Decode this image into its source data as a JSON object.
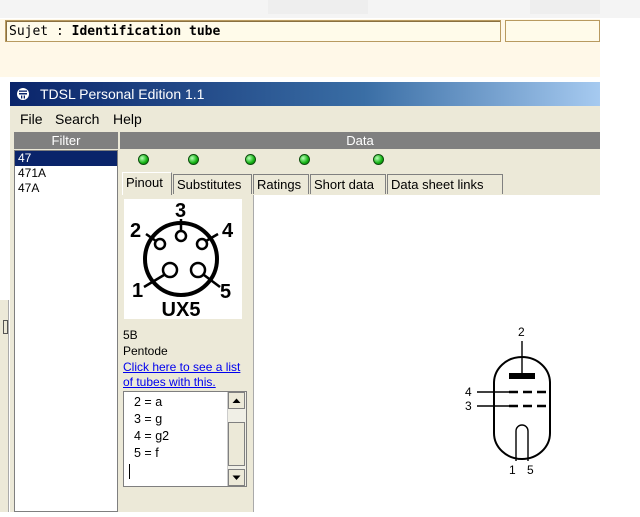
{
  "subject": {
    "label": "Sujet : ",
    "value": "Identification tube"
  },
  "window": {
    "title": "TDSL Personal Edition 1.1"
  },
  "menu": {
    "file": "File",
    "search": "Search",
    "help": "Help"
  },
  "filter": {
    "header": "Filter",
    "items": [
      "47",
      "471A",
      "47A"
    ],
    "selected": "47"
  },
  "data": {
    "header": "Data",
    "tabs": [
      "Pinout",
      "Substitutes",
      "Ratings",
      "Short data",
      "Data sheet links"
    ],
    "active_tab": "Pinout"
  },
  "pinout": {
    "base_numbers": [
      "1",
      "2",
      "3",
      "4",
      "5"
    ],
    "base_label": "UX5",
    "base_code": "5B",
    "tube_type": "Pentode",
    "link_text": "Click here to see a list of tubes with this.",
    "pins": [
      "2 = a",
      "3 = g",
      "4 = g2",
      "5 = f"
    ]
  },
  "schematic": {
    "pin_top": "2",
    "pin_g2": "4",
    "pin_g1": "3",
    "pin_f1": "1",
    "pin_f2": "5"
  },
  "colors": {
    "led": "#13b313",
    "selection": "#0a246a",
    "header_bg": "#808080"
  }
}
